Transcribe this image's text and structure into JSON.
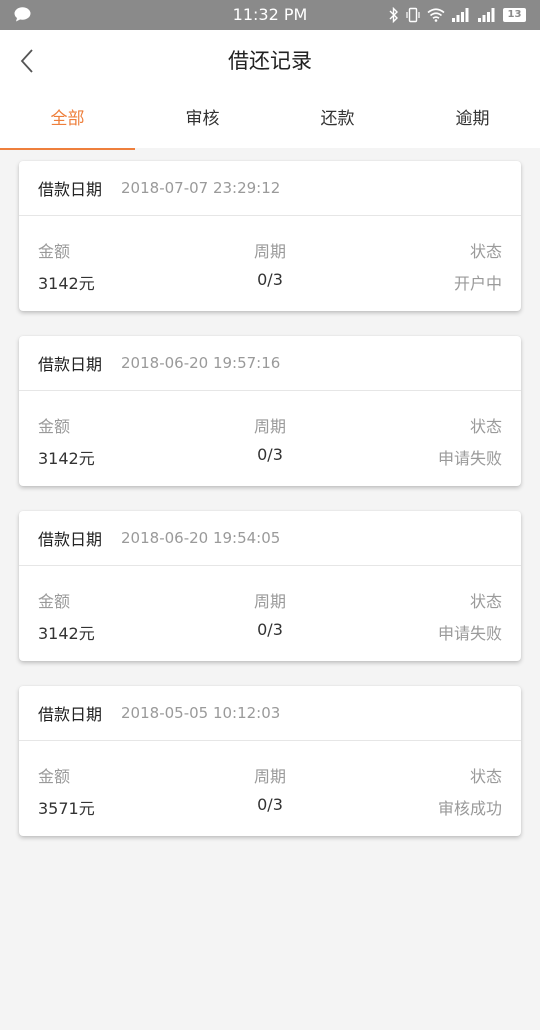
{
  "status_bar": {
    "time": "11:32 PM",
    "battery": "13",
    "icons": [
      "message-icon",
      "bluetooth-icon",
      "vibrate-icon",
      "wifi-icon",
      "signal-icon",
      "signal-icon",
      "battery-icon"
    ]
  },
  "header": {
    "title": "借还记录",
    "back_icon": "chevron-left-icon"
  },
  "tabs": [
    {
      "label": "全部",
      "active": true
    },
    {
      "label": "审核",
      "active": false
    },
    {
      "label": "还款",
      "active": false
    },
    {
      "label": "逾期",
      "active": false
    }
  ],
  "accent_color": "#ee7f3c",
  "column_labels": {
    "amount": "金额",
    "period": "周期",
    "status": "状态"
  },
  "records": [
    {
      "date_label": "借款日期",
      "date": "2018-07-07 23:29:12",
      "amount": "3142元",
      "period": "0/3",
      "status": "开户中"
    },
    {
      "date_label": "借款日期",
      "date": "2018-06-20 19:57:16",
      "amount": "3142元",
      "period": "0/3",
      "status": "申请失败"
    },
    {
      "date_label": "借款日期",
      "date": "2018-06-20 19:54:05",
      "amount": "3142元",
      "period": "0/3",
      "status": "申请失败"
    },
    {
      "date_label": "借款日期",
      "date": "2018-05-05 10:12:03",
      "amount": "3571元",
      "period": "0/3",
      "status": "审核成功"
    }
  ]
}
